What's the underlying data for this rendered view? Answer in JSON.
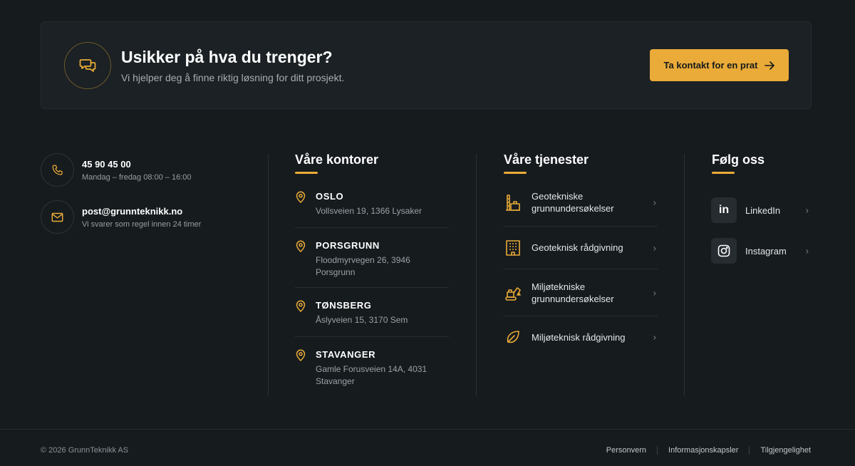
{
  "cta": {
    "title": "Usikker på hva du trenger?",
    "subtitle": "Vi hjelper deg å finne riktig løsning for ditt prosjekt.",
    "button_label": "Ta kontakt for en prat",
    "icon": "chat-bubbles-icon"
  },
  "contact": {
    "phone": "45 90 45 00",
    "phone_hours": "Mandag – fredag 08:00 – 16:00",
    "email": "post@grunnteknikk.no",
    "email_note": "Vi svarer som regel innen 24 timer"
  },
  "offices": {
    "title": "Våre kontorer",
    "items": [
      {
        "city": "OSLO",
        "address": "Vollsveien 19, 1366 Lysaker"
      },
      {
        "city": "PORSGRUNN",
        "address": "Floodmyrvegen 26, 3946 Porsgrunn"
      },
      {
        "city": "TØNSBERG",
        "address": "Åslyveien 15, 3170 Sem"
      },
      {
        "city": "STAVANGER",
        "address": "Gamle Forusveien 14A, 4031 Stavanger"
      }
    ]
  },
  "services": {
    "title": "Våre tjenester",
    "items": [
      {
        "label": "Geotekniske grunnundersøkelser",
        "icon": "drilling-rig-icon"
      },
      {
        "label": "Geoteknisk rådgivning",
        "icon": "building-icon"
      },
      {
        "label": "Miljøtekniske grunnundersøkelser",
        "icon": "excavator-icon"
      },
      {
        "label": "Miljøteknisk rådgivning",
        "icon": "leaf-icon"
      }
    ]
  },
  "social": {
    "title": "Følg oss",
    "items": [
      {
        "label": "LinkedIn",
        "icon": "linkedin-icon"
      },
      {
        "label": "Instagram",
        "icon": "instagram-icon"
      }
    ]
  },
  "footer": {
    "copyright": "© 2026 GrunnTeknikk AS",
    "links": [
      "Personvern",
      "Informasjonskapsler",
      "Tilgjengelighet"
    ]
  },
  "colors": {
    "background": "#161b1e",
    "panel": "#1b2124",
    "accent": "#eaab38",
    "text": "#ffffff",
    "muted": "#9aa1a6"
  }
}
